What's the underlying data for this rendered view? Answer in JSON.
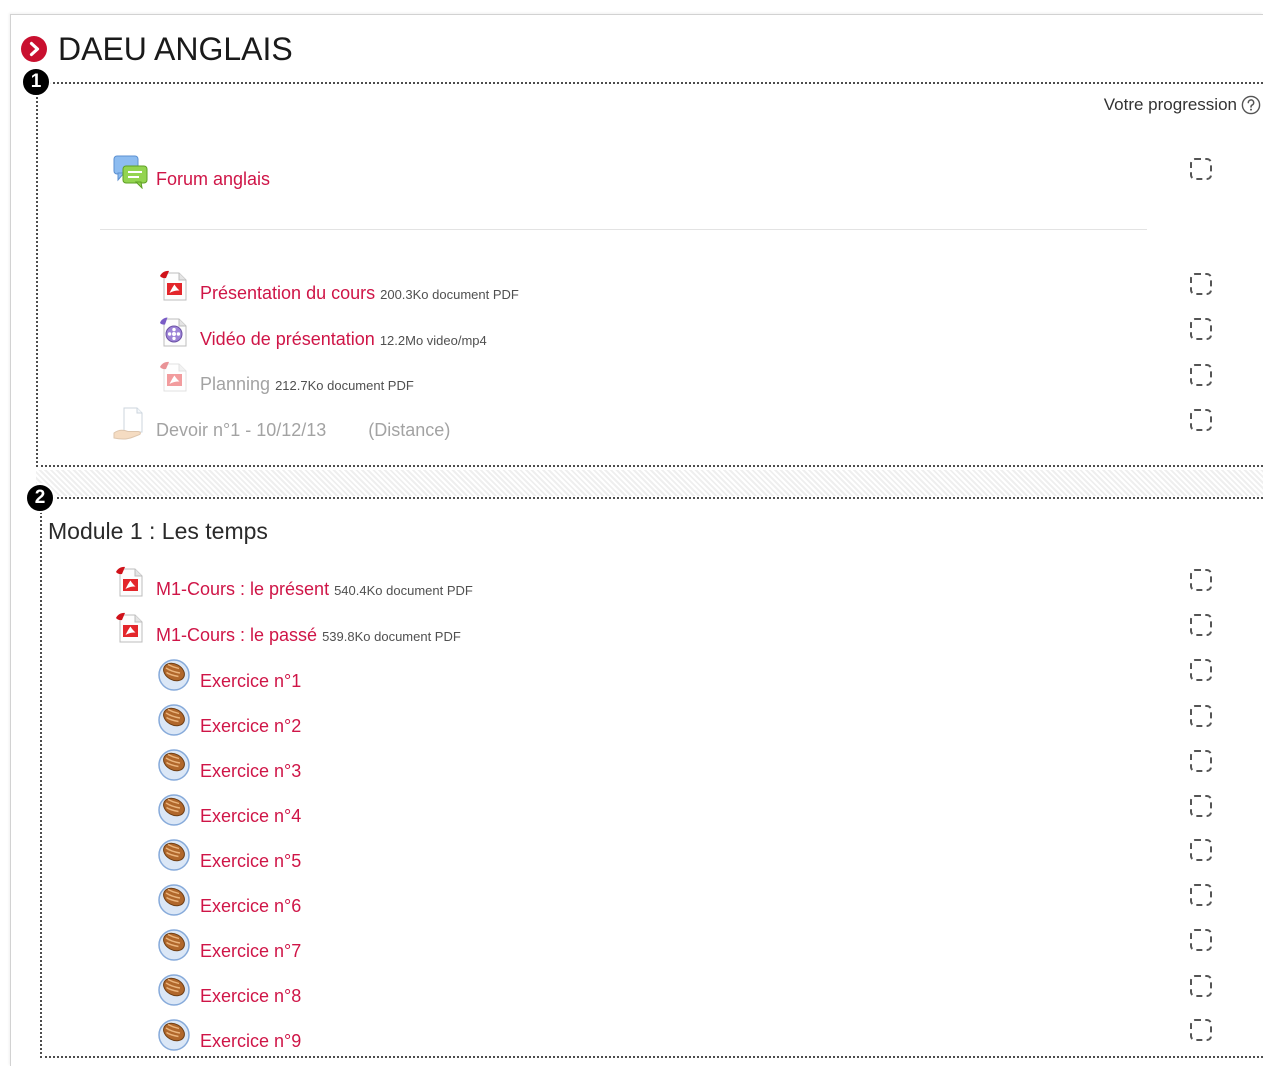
{
  "course": {
    "title": "DAEU ANGLAIS",
    "title_icon": "chevron-right-circle-icon"
  },
  "progress": {
    "label": "Votre progression",
    "help_icon": "question-circle-icon"
  },
  "callouts": [
    "1",
    "2"
  ],
  "colors": {
    "link": "#cf1547",
    "dimmed": "#a3a3a3",
    "title_icon": "#c9102f"
  },
  "sections": [
    {
      "activities": [
        {
          "icon": "forum-icon",
          "name": "Forum anglais",
          "dimmed": false,
          "completed": false
        },
        {
          "icon": "pdf-icon",
          "name": "Présentation du cours",
          "meta": "200.3Ko document PDF",
          "dimmed": false,
          "completed": false
        },
        {
          "icon": "video-icon",
          "name": "Vidéo de présentation",
          "meta": "12.2Mo video/mp4",
          "dimmed": false,
          "completed": false
        },
        {
          "icon": "pdf-icon",
          "name": "Planning",
          "meta": "212.7Ko document PDF",
          "dimmed": true,
          "completed": false
        },
        {
          "icon": "assignment-icon",
          "name": "Devoir n°1 - 10/12/13",
          "group": "(Distance)",
          "dimmed": true,
          "completed": false
        }
      ]
    },
    {
      "heading": "Module 1 : Les temps",
      "activities": [
        {
          "icon": "pdf-icon",
          "name": "M1-Cours : le présent",
          "meta": "540.4Ko document PDF",
          "dimmed": false,
          "completed": false
        },
        {
          "icon": "pdf-icon",
          "name": "M1-Cours : le passé",
          "meta": "539.8Ko document PDF",
          "dimmed": false,
          "completed": false
        },
        {
          "icon": "exercise-icon",
          "name": "Exercice n°1",
          "dimmed": false,
          "completed": false
        },
        {
          "icon": "exercise-icon",
          "name": "Exercice n°2",
          "dimmed": false,
          "completed": false
        },
        {
          "icon": "exercise-icon",
          "name": "Exercice n°3",
          "dimmed": false,
          "completed": false
        },
        {
          "icon": "exercise-icon",
          "name": "Exercice n°4",
          "dimmed": false,
          "completed": false
        },
        {
          "icon": "exercise-icon",
          "name": "Exercice n°5",
          "dimmed": false,
          "completed": false
        },
        {
          "icon": "exercise-icon",
          "name": "Exercice n°6",
          "dimmed": false,
          "completed": false
        },
        {
          "icon": "exercise-icon",
          "name": "Exercice n°7",
          "dimmed": false,
          "completed": false
        },
        {
          "icon": "exercise-icon",
          "name": "Exercice n°8",
          "dimmed": false,
          "completed": false
        },
        {
          "icon": "exercise-icon",
          "name": "Exercice n°9",
          "dimmed": false,
          "completed": false
        }
      ]
    }
  ]
}
